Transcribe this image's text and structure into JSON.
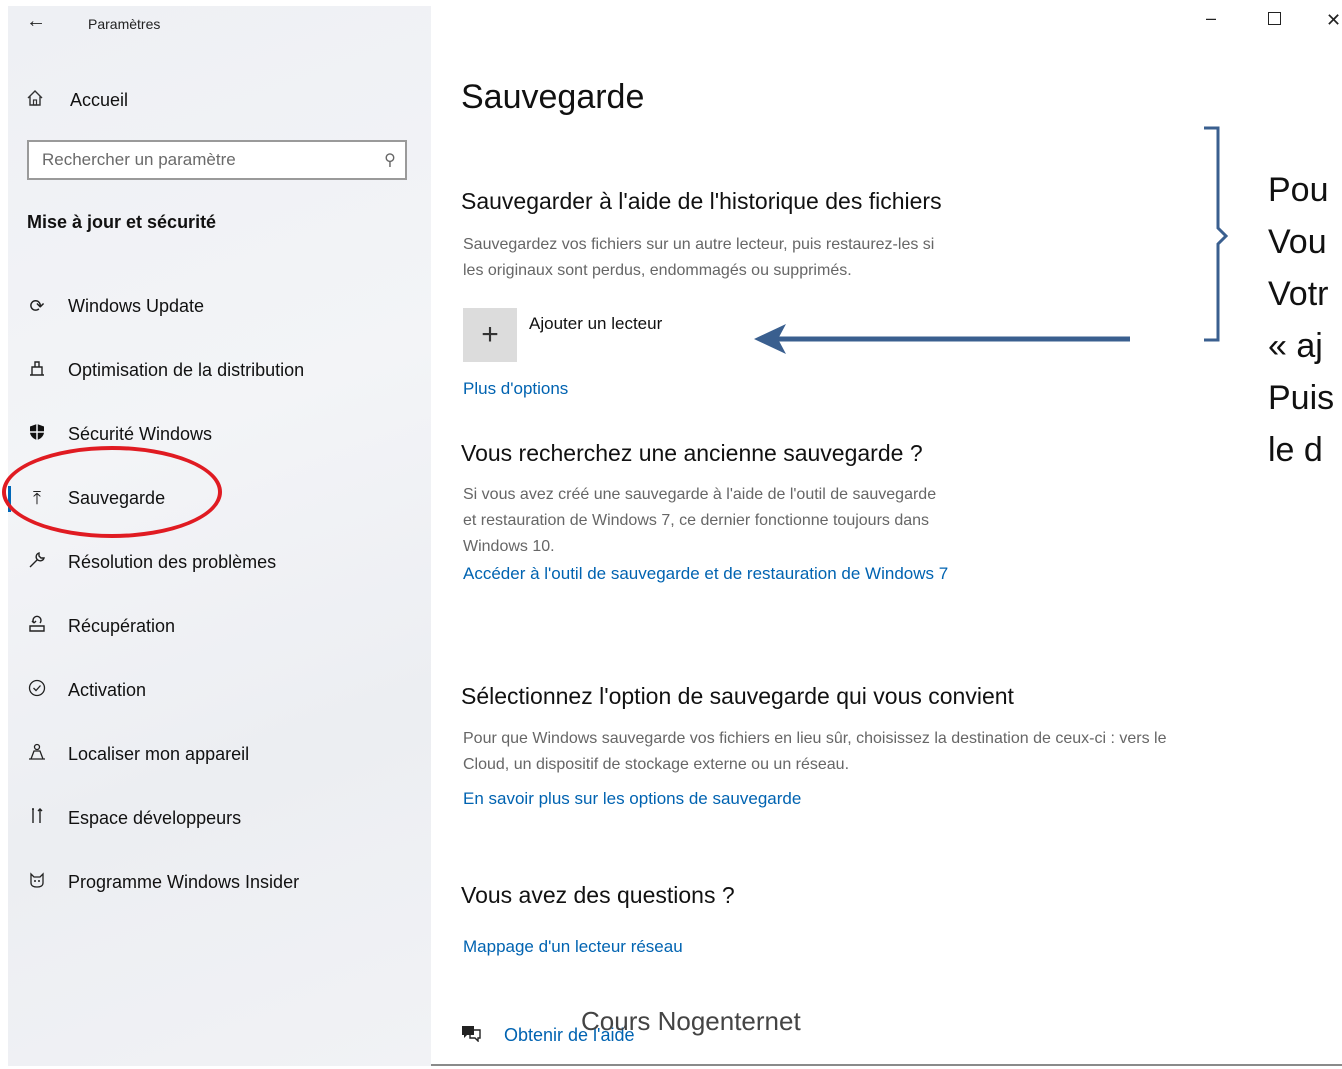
{
  "window": {
    "title": "Paramètres"
  },
  "sidebar": {
    "home": "Accueil",
    "search_placeholder": "Rechercher un paramètre",
    "section": "Mise à jour et sécurité",
    "items": [
      {
        "label": "Windows Update",
        "icon": "sync-icon"
      },
      {
        "label": "Optimisation de la distribution",
        "icon": "delivery-icon"
      },
      {
        "label": "Sécurité Windows",
        "icon": "shield-icon"
      },
      {
        "label": "Sauvegarde",
        "icon": "upload-icon",
        "active": true
      },
      {
        "label": "Résolution des problèmes",
        "icon": "wrench-icon"
      },
      {
        "label": "Récupération",
        "icon": "recovery-icon"
      },
      {
        "label": "Activation",
        "icon": "check-circle-icon"
      },
      {
        "label": "Localiser mon appareil",
        "icon": "person-locate-icon"
      },
      {
        "label": "Espace développeurs",
        "icon": "developer-tools-icon"
      },
      {
        "label": "Programme Windows Insider",
        "icon": "insider-cat-icon"
      }
    ]
  },
  "main": {
    "title": "Sauvegarde",
    "file_history": {
      "heading": "Sauvegarder à l'aide de l'historique des fichiers",
      "desc1": "Sauvegardez vos fichiers sur un autre lecteur, puis restaurez-les si",
      "desc2": "les originaux sont perdus, endommagés ou supprimés.",
      "add_drive": "Ajouter un lecteur",
      "more_options": "Plus d'options"
    },
    "old_backup": {
      "heading": "Vous recherchez une ancienne sauvegarde ?",
      "desc1": "Si vous avez créé une sauvegarde à l'aide de l'outil de sauvegarde",
      "desc2": "et restauration de Windows 7, ce dernier fonctionne toujours dans",
      "desc3": "Windows 10.",
      "link": "Accéder à l'outil de sauvegarde et de restauration de Windows 7"
    },
    "select_option": {
      "heading": "Sélectionnez l'option de sauvegarde qui vous convient",
      "desc1": "Pour que Windows sauvegarde vos fichiers en lieu sûr, choisissez la destination de ceux-ci : vers le",
      "desc2": "Cloud, un dispositif de stockage externe ou un réseau.",
      "link": "En savoir plus sur les options de sauvegarde"
    },
    "questions": {
      "heading": "Vous avez des questions ?",
      "link": "Mappage d'un lecteur réseau"
    },
    "help": "Obtenir de l'aide"
  },
  "annotation": {
    "lines": [
      "Pou",
      "Vou",
      "Votr",
      "« aj",
      "Puis",
      "le d"
    ],
    "arrow_color": "#3a5f8f",
    "circle_color": "#e01b22"
  },
  "watermark": "Cours Nogenternet",
  "colors": {
    "link": "#0063b1",
    "accent": "#0067b8"
  }
}
